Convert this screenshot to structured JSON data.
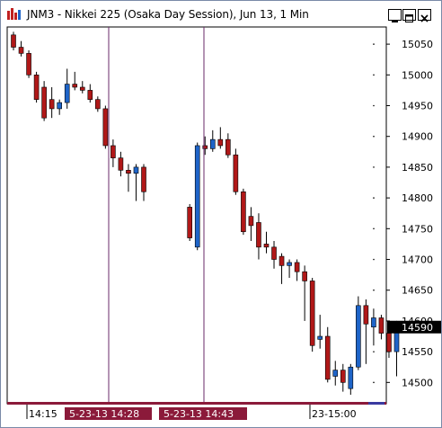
{
  "window": {
    "title": "JNM3 - Nikkei 225 (Osaka Day Session), Jun 13, 1 Min"
  },
  "colors": {
    "up": "#1e64c8",
    "down": "#b01818",
    "session_line": "#6a2a6a",
    "time_marker_bg": "#8b1a3a",
    "last_price_bg": "#000000",
    "bottom_bar": "#8b1a3a",
    "bottom_bar_right": "#3a3aa0"
  },
  "chart_data": {
    "type": "candlestick",
    "symbol": "JNM3",
    "ylim": [
      14480,
      15075
    ],
    "yticks": [
      15050,
      15000,
      14950,
      14900,
      14850,
      14800,
      14750,
      14700,
      14650,
      14600,
      14550,
      14500
    ],
    "last_price": "14590",
    "x_labels": [
      {
        "text": "14:15",
        "marker": false
      },
      {
        "text": "5-23-13 14:28",
        "marker": true
      },
      {
        "text": "5-23-13 14:43",
        "marker": true
      },
      {
        "text": "23-15:00",
        "marker": false
      }
    ],
    "candles": [
      {
        "o": 15065,
        "h": 15070,
        "l": 15040,
        "c": 15045
      },
      {
        "o": 15045,
        "h": 15055,
        "l": 15030,
        "c": 15035
      },
      {
        "o": 15035,
        "h": 15040,
        "l": 14995,
        "c": 15000
      },
      {
        "o": 15000,
        "h": 15005,
        "l": 14955,
        "c": 14960
      },
      {
        "o": 14980,
        "h": 14990,
        "l": 14925,
        "c": 14930
      },
      {
        "o": 14960,
        "h": 14980,
        "l": 14930,
        "c": 14945
      },
      {
        "o": 14945,
        "h": 14960,
        "l": 14935,
        "c": 14955
      },
      {
        "o": 14955,
        "h": 15010,
        "l": 14945,
        "c": 14985
      },
      {
        "o": 14985,
        "h": 15005,
        "l": 14975,
        "c": 14980
      },
      {
        "o": 14980,
        "h": 14990,
        "l": 14970,
        "c": 14975
      },
      {
        "o": 14975,
        "h": 14985,
        "l": 14955,
        "c": 14960
      },
      {
        "o": 14960,
        "h": 14965,
        "l": 14940,
        "c": 14945
      },
      {
        "o": 14945,
        "h": 14950,
        "l": 14880,
        "c": 14885
      },
      {
        "o": 14885,
        "h": 14895,
        "l": 14850,
        "c": 14865
      },
      {
        "o": 14865,
        "h": 14875,
        "l": 14835,
        "c": 14845
      },
      {
        "o": 14845,
        "h": 14855,
        "l": 14810,
        "c": 14840
      },
      {
        "o": 14840,
        "h": 14855,
        "l": 14795,
        "c": 14850
      },
      {
        "o": 14850,
        "h": 14855,
        "l": 14795,
        "c": 14810
      },
      {
        "gap": true
      },
      {
        "o": 14785,
        "h": 14790,
        "l": 14730,
        "c": 14735
      },
      {
        "o": 14720,
        "h": 14890,
        "l": 14715,
        "c": 14885
      },
      {
        "o": 14885,
        "h": 14900,
        "l": 14870,
        "c": 14880
      },
      {
        "o": 14880,
        "h": 14910,
        "l": 14875,
        "c": 14895
      },
      {
        "o": 14895,
        "h": 14915,
        "l": 14880,
        "c": 14885
      },
      {
        "o": 14895,
        "h": 14905,
        "l": 14865,
        "c": 14870
      },
      {
        "o": 14870,
        "h": 14880,
        "l": 14805,
        "c": 14810
      },
      {
        "o": 14810,
        "h": 14815,
        "l": 14740,
        "c": 14745
      },
      {
        "o": 14770,
        "h": 14785,
        "l": 14730,
        "c": 14755
      },
      {
        "o": 14760,
        "h": 14775,
        "l": 14700,
        "c": 14720
      },
      {
        "o": 14725,
        "h": 14745,
        "l": 14710,
        "c": 14720
      },
      {
        "o": 14720,
        "h": 14730,
        "l": 14685,
        "c": 14700
      },
      {
        "o": 14705,
        "h": 14710,
        "l": 14660,
        "c": 14690
      },
      {
        "o": 14690,
        "h": 14700,
        "l": 14670,
        "c": 14695
      },
      {
        "o": 14695,
        "h": 14700,
        "l": 14665,
        "c": 14680
      },
      {
        "o": 14680,
        "h": 14690,
        "l": 14600,
        "c": 14665
      },
      {
        "o": 14665,
        "h": 14670,
        "l": 14550,
        "c": 14560
      },
      {
        "o": 14570,
        "h": 14610,
        "l": 14555,
        "c": 14575
      },
      {
        "o": 14575,
        "h": 14590,
        "l": 14500,
        "c": 14505
      },
      {
        "o": 14510,
        "h": 14535,
        "l": 14495,
        "c": 14520
      },
      {
        "o": 14520,
        "h": 14530,
        "l": 14485,
        "c": 14500
      },
      {
        "o": 14490,
        "h": 14530,
        "l": 14480,
        "c": 14525
      },
      {
        "o": 14525,
        "h": 14640,
        "l": 14520,
        "c": 14625
      },
      {
        "o": 14625,
        "h": 14635,
        "l": 14530,
        "c": 14595
      },
      {
        "o": 14590,
        "h": 14620,
        "l": 14560,
        "c": 14605
      },
      {
        "o": 14605,
        "h": 14610,
        "l": 14570,
        "c": 14580
      },
      {
        "o": 14580,
        "h": 14590,
        "l": 14540,
        "c": 14550
      },
      {
        "o": 14550,
        "h": 14600,
        "l": 14510,
        "c": 14585
      }
    ],
    "session_separators_at_index": [
      14,
      20
    ]
  }
}
